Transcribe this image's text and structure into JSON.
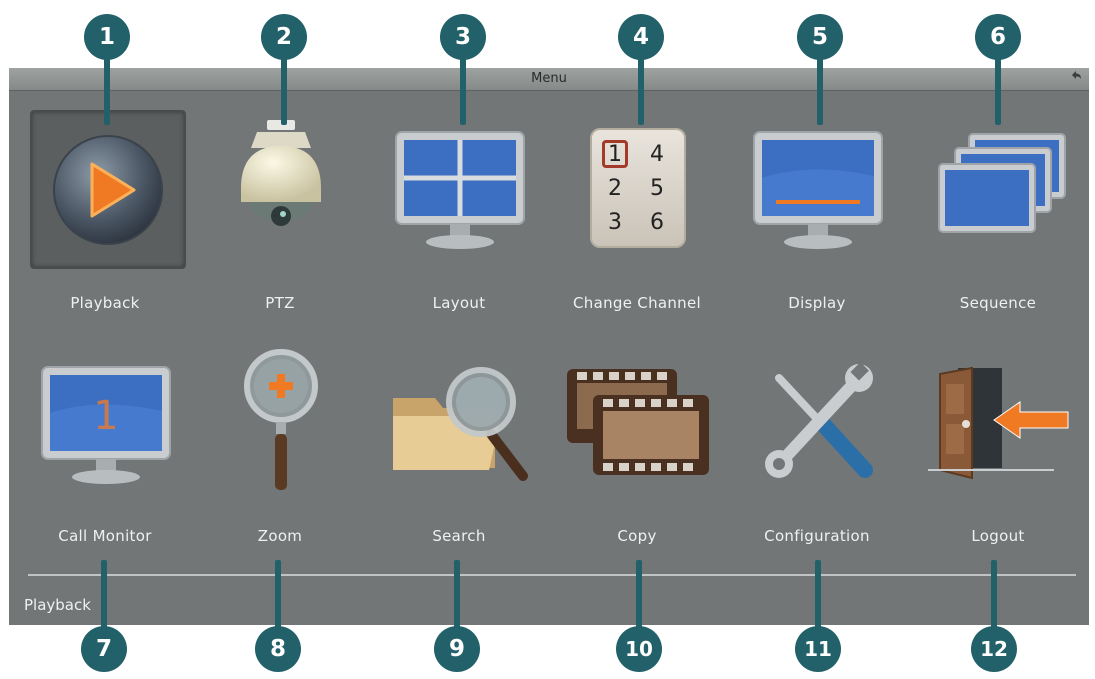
{
  "window": {
    "title": "Menu",
    "back_icon": "back-arrow-icon"
  },
  "menu_items": [
    {
      "label": "Playback",
      "icon": "playback-icon",
      "selected": true
    },
    {
      "label": "PTZ",
      "icon": "ptz-camera-icon"
    },
    {
      "label": "Layout",
      "icon": "layout-icon"
    },
    {
      "label": "Change  Channel",
      "icon": "change-channel-icon"
    },
    {
      "label": "Display",
      "icon": "display-icon"
    },
    {
      "label": "Sequence",
      "icon": "sequence-icon"
    },
    {
      "label": "Call  Monitor",
      "icon": "call-monitor-icon"
    },
    {
      "label": "Zoom",
      "icon": "zoom-icon"
    },
    {
      "label": "Search",
      "icon": "search-icon"
    },
    {
      "label": "Copy",
      "icon": "copy-icon"
    },
    {
      "label": "Configuration",
      "icon": "configuration-icon"
    },
    {
      "label": "Logout",
      "icon": "logout-icon"
    }
  ],
  "channel_grid": [
    "1",
    "4",
    "2",
    "5",
    "3",
    "6"
  ],
  "call_monitor_number": "1",
  "status_bar": {
    "text": "Playback"
  },
  "callouts": [
    "1",
    "2",
    "3",
    "4",
    "5",
    "6",
    "7",
    "8",
    "9",
    "10",
    "11",
    "12"
  ],
  "colors": {
    "panel": "#727677",
    "callout": "#22616a",
    "label": "#f0f0f0"
  }
}
